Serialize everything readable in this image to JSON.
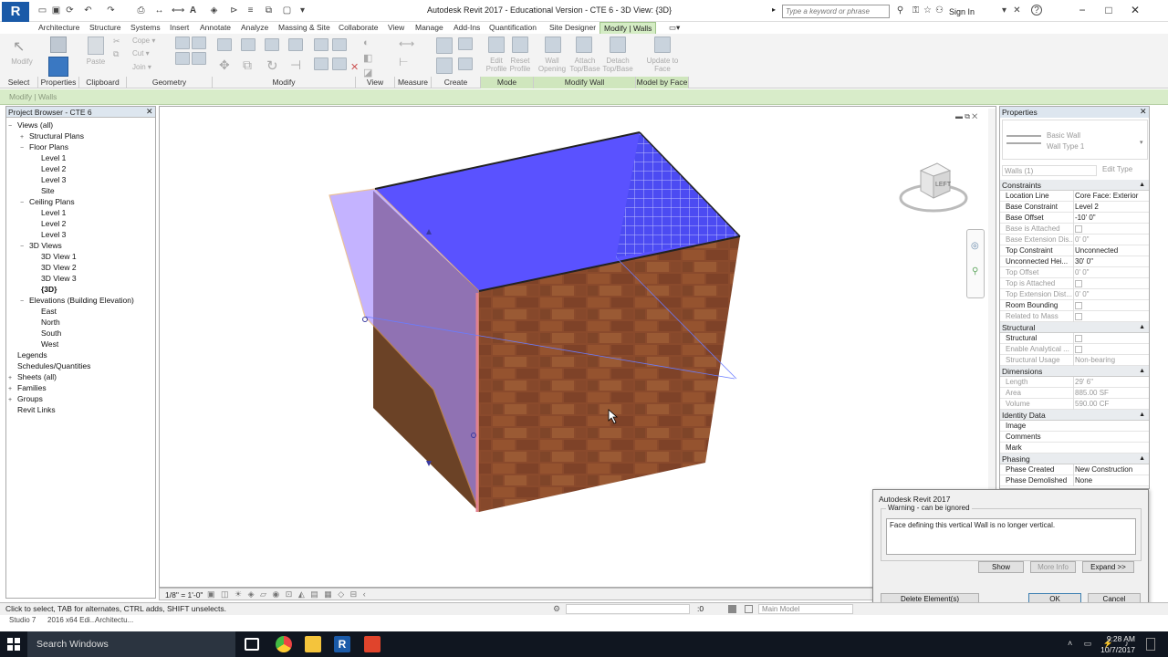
{
  "window": {
    "title": "Autodesk Revit 2017 - Educational Version -    CTE 6 - 3D View: {3D}",
    "search_placeholder": "Type a keyword or phrase",
    "sign_in": "Sign In"
  },
  "tabs": [
    "Architecture",
    "Structure",
    "Systems",
    "Insert",
    "Annotate",
    "Analyze",
    "Massing & Site",
    "Collaborate",
    "View",
    "Manage",
    "Add-Ins",
    "Quantification",
    "Site Designer",
    "Modify | Walls"
  ],
  "ribbon": {
    "buttons": {
      "modify": "Modify",
      "paste": "Paste",
      "cope": "Cope",
      "cut": "Cut",
      "join": "Join",
      "edit_profile": "Edit Profile",
      "reset_profile": "Reset Profile",
      "wall_opening": "Wall Opening",
      "attach": "Attach Top/Base",
      "detach": "Detach Top/Base",
      "update_to_face": "Update to Face"
    },
    "panels": {
      "select": "Select",
      "properties": "Properties",
      "clipboard": "Clipboard",
      "geometry": "Geometry",
      "modify": "Modify",
      "view": "View",
      "measure": "Measure",
      "create": "Create",
      "mode": "Mode",
      "modify_wall": "Modify Wall",
      "model_by_face": "Model by Face"
    },
    "option_bar": "Modify | Walls"
  },
  "browser": {
    "title": "Project Browser - CTE 6",
    "items": [
      {
        "label": "Views (all)",
        "level": 0,
        "exp": "−"
      },
      {
        "label": "Structural Plans",
        "level": 1,
        "exp": "+"
      },
      {
        "label": "Floor Plans",
        "level": 1,
        "exp": "−"
      },
      {
        "label": "Level 1",
        "level": 2,
        "exp": ""
      },
      {
        "label": "Level 2",
        "level": 2,
        "exp": ""
      },
      {
        "label": "Level 3",
        "level": 2,
        "exp": ""
      },
      {
        "label": "Site",
        "level": 2,
        "exp": ""
      },
      {
        "label": "Ceiling Plans",
        "level": 1,
        "exp": "−"
      },
      {
        "label": "Level 1",
        "level": 2,
        "exp": ""
      },
      {
        "label": "Level 2",
        "level": 2,
        "exp": ""
      },
      {
        "label": "Level 3",
        "level": 2,
        "exp": ""
      },
      {
        "label": "3D Views",
        "level": 1,
        "exp": "−"
      },
      {
        "label": "3D View 1",
        "level": 2,
        "exp": ""
      },
      {
        "label": "3D View 2",
        "level": 2,
        "exp": ""
      },
      {
        "label": "3D View 3",
        "level": 2,
        "exp": ""
      },
      {
        "label": "{3D}",
        "level": 2,
        "exp": "",
        "bold": true
      },
      {
        "label": "Elevations (Building Elevation)",
        "level": 1,
        "exp": "−"
      },
      {
        "label": "East",
        "level": 2,
        "exp": ""
      },
      {
        "label": "North",
        "level": 2,
        "exp": ""
      },
      {
        "label": "South",
        "level": 2,
        "exp": ""
      },
      {
        "label": "West",
        "level": 2,
        "exp": ""
      },
      {
        "label": "Legends",
        "level": 0,
        "exp": ""
      },
      {
        "label": "Schedules/Quantities",
        "level": 0,
        "exp": ""
      },
      {
        "label": "Sheets (all)",
        "level": 0,
        "exp": "+"
      },
      {
        "label": "Families",
        "level": 0,
        "exp": "+"
      },
      {
        "label": "Groups",
        "level": 0,
        "exp": "+"
      },
      {
        "label": "Revit Links",
        "level": 0,
        "exp": ""
      }
    ]
  },
  "viewcube": {
    "face": "LEFT"
  },
  "viewbar": {
    "scale": "1/8\" = 1'-0\""
  },
  "properties": {
    "title": "Properties",
    "type_family": "Basic Wall",
    "type_name": "Wall Type 1",
    "selector": "Walls (1)",
    "edit_type": "Edit Type",
    "groups": [
      {
        "name": "Constraints",
        "rows": [
          {
            "n": "Location Line",
            "v": "Core Face: Exterior"
          },
          {
            "n": "Base Constraint",
            "v": "Level 2"
          },
          {
            "n": "Base Offset",
            "v": "-10' 0\""
          },
          {
            "n": "Base is Attached",
            "v": "",
            "chk": true,
            "grey": true
          },
          {
            "n": "Base Extension Dis...",
            "v": "0' 0\"",
            "grey": true
          },
          {
            "n": "Top Constraint",
            "v": "Unconnected"
          },
          {
            "n": "Unconnected Hei...",
            "v": "30' 0\""
          },
          {
            "n": "Top Offset",
            "v": "0' 0\"",
            "grey": true
          },
          {
            "n": "Top is Attached",
            "v": "",
            "chk": true,
            "grey": true
          },
          {
            "n": "Top Extension Dist...",
            "v": "0' 0\"",
            "grey": true
          },
          {
            "n": "Room Bounding",
            "v": "",
            "chk": true
          },
          {
            "n": "Related to Mass",
            "v": "",
            "chk": true,
            "grey": true
          }
        ]
      },
      {
        "name": "Structural",
        "rows": [
          {
            "n": "Structural",
            "v": "",
            "chk": true
          },
          {
            "n": "Enable Analytical ...",
            "v": "",
            "chk": true,
            "grey": true
          },
          {
            "n": "Structural Usage",
            "v": "Non-bearing",
            "grey": true
          }
        ]
      },
      {
        "name": "Dimensions",
        "rows": [
          {
            "n": "Length",
            "v": "29' 6\"",
            "grey": true
          },
          {
            "n": "Area",
            "v": "885.00 SF",
            "grey": true
          },
          {
            "n": "Volume",
            "v": "590.00 CF",
            "grey": true
          }
        ]
      },
      {
        "name": "Identity Data",
        "rows": [
          {
            "n": "Image",
            "v": ""
          },
          {
            "n": "Comments",
            "v": ""
          },
          {
            "n": "Mark",
            "v": ""
          }
        ]
      },
      {
        "name": "Phasing",
        "rows": [
          {
            "n": "Phase Created",
            "v": "New Construction"
          },
          {
            "n": "Phase Demolished",
            "v": "None"
          }
        ]
      }
    ]
  },
  "dialog": {
    "title": "Autodesk Revit 2017",
    "group": "Warning - can be ignored",
    "message": "Face defining this vertical Wall is no longer vertical.",
    "show": "Show",
    "more_info": "More Info",
    "expand": "Expand >>",
    "delete": "Delete Element(s)",
    "ok": "OK",
    "cancel": "Cancel"
  },
  "status": {
    "hint": "Click to select, TAB for alternates, CTRL adds, SHIFT unselects.",
    "filter": ":0",
    "model": "Main Model"
  },
  "status2": {
    "a": "Studio 7",
    "b": "2016 x64 Edi...",
    "c": "Architectu..."
  },
  "taskbar": {
    "search": "Search Windows",
    "time": "9:28 AM",
    "date": "10/7/2017"
  },
  "colors": {
    "selection": "#5a52ff",
    "brick": "#8a4a2c",
    "ribbon_ctx": "#d4ecc4"
  }
}
